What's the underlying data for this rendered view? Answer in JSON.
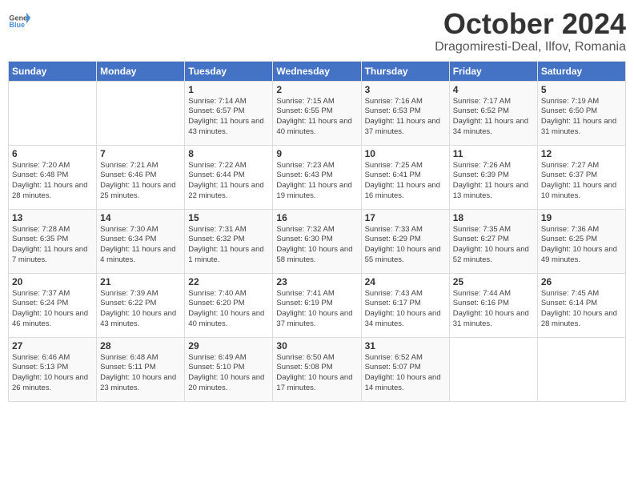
{
  "header": {
    "logo_general": "General",
    "logo_blue": "Blue",
    "month": "October 2024",
    "location": "Dragomiresti-Deal, Ilfov, Romania"
  },
  "days_of_week": [
    "Sunday",
    "Monday",
    "Tuesday",
    "Wednesday",
    "Thursday",
    "Friday",
    "Saturday"
  ],
  "weeks": [
    [
      {
        "day": null,
        "info": null
      },
      {
        "day": null,
        "info": null
      },
      {
        "day": "1",
        "info": "Sunrise: 7:14 AM\nSunset: 6:57 PM\nDaylight: 11 hours and 43 minutes."
      },
      {
        "day": "2",
        "info": "Sunrise: 7:15 AM\nSunset: 6:55 PM\nDaylight: 11 hours and 40 minutes."
      },
      {
        "day": "3",
        "info": "Sunrise: 7:16 AM\nSunset: 6:53 PM\nDaylight: 11 hours and 37 minutes."
      },
      {
        "day": "4",
        "info": "Sunrise: 7:17 AM\nSunset: 6:52 PM\nDaylight: 11 hours and 34 minutes."
      },
      {
        "day": "5",
        "info": "Sunrise: 7:19 AM\nSunset: 6:50 PM\nDaylight: 11 hours and 31 minutes."
      }
    ],
    [
      {
        "day": "6",
        "info": "Sunrise: 7:20 AM\nSunset: 6:48 PM\nDaylight: 11 hours and 28 minutes."
      },
      {
        "day": "7",
        "info": "Sunrise: 7:21 AM\nSunset: 6:46 PM\nDaylight: 11 hours and 25 minutes."
      },
      {
        "day": "8",
        "info": "Sunrise: 7:22 AM\nSunset: 6:44 PM\nDaylight: 11 hours and 22 minutes."
      },
      {
        "day": "9",
        "info": "Sunrise: 7:23 AM\nSunset: 6:43 PM\nDaylight: 11 hours and 19 minutes."
      },
      {
        "day": "10",
        "info": "Sunrise: 7:25 AM\nSunset: 6:41 PM\nDaylight: 11 hours and 16 minutes."
      },
      {
        "day": "11",
        "info": "Sunrise: 7:26 AM\nSunset: 6:39 PM\nDaylight: 11 hours and 13 minutes."
      },
      {
        "day": "12",
        "info": "Sunrise: 7:27 AM\nSunset: 6:37 PM\nDaylight: 11 hours and 10 minutes."
      }
    ],
    [
      {
        "day": "13",
        "info": "Sunrise: 7:28 AM\nSunset: 6:35 PM\nDaylight: 11 hours and 7 minutes."
      },
      {
        "day": "14",
        "info": "Sunrise: 7:30 AM\nSunset: 6:34 PM\nDaylight: 11 hours and 4 minutes."
      },
      {
        "day": "15",
        "info": "Sunrise: 7:31 AM\nSunset: 6:32 PM\nDaylight: 11 hours and 1 minute."
      },
      {
        "day": "16",
        "info": "Sunrise: 7:32 AM\nSunset: 6:30 PM\nDaylight: 10 hours and 58 minutes."
      },
      {
        "day": "17",
        "info": "Sunrise: 7:33 AM\nSunset: 6:29 PM\nDaylight: 10 hours and 55 minutes."
      },
      {
        "day": "18",
        "info": "Sunrise: 7:35 AM\nSunset: 6:27 PM\nDaylight: 10 hours and 52 minutes."
      },
      {
        "day": "19",
        "info": "Sunrise: 7:36 AM\nSunset: 6:25 PM\nDaylight: 10 hours and 49 minutes."
      }
    ],
    [
      {
        "day": "20",
        "info": "Sunrise: 7:37 AM\nSunset: 6:24 PM\nDaylight: 10 hours and 46 minutes."
      },
      {
        "day": "21",
        "info": "Sunrise: 7:39 AM\nSunset: 6:22 PM\nDaylight: 10 hours and 43 minutes."
      },
      {
        "day": "22",
        "info": "Sunrise: 7:40 AM\nSunset: 6:20 PM\nDaylight: 10 hours and 40 minutes."
      },
      {
        "day": "23",
        "info": "Sunrise: 7:41 AM\nSunset: 6:19 PM\nDaylight: 10 hours and 37 minutes."
      },
      {
        "day": "24",
        "info": "Sunrise: 7:43 AM\nSunset: 6:17 PM\nDaylight: 10 hours and 34 minutes."
      },
      {
        "day": "25",
        "info": "Sunrise: 7:44 AM\nSunset: 6:16 PM\nDaylight: 10 hours and 31 minutes."
      },
      {
        "day": "26",
        "info": "Sunrise: 7:45 AM\nSunset: 6:14 PM\nDaylight: 10 hours and 28 minutes."
      }
    ],
    [
      {
        "day": "27",
        "info": "Sunrise: 6:46 AM\nSunset: 5:13 PM\nDaylight: 10 hours and 26 minutes."
      },
      {
        "day": "28",
        "info": "Sunrise: 6:48 AM\nSunset: 5:11 PM\nDaylight: 10 hours and 23 minutes."
      },
      {
        "day": "29",
        "info": "Sunrise: 6:49 AM\nSunset: 5:10 PM\nDaylight: 10 hours and 20 minutes."
      },
      {
        "day": "30",
        "info": "Sunrise: 6:50 AM\nSunset: 5:08 PM\nDaylight: 10 hours and 17 minutes."
      },
      {
        "day": "31",
        "info": "Sunrise: 6:52 AM\nSunset: 5:07 PM\nDaylight: 10 hours and 14 minutes."
      },
      {
        "day": null,
        "info": null
      },
      {
        "day": null,
        "info": null
      }
    ]
  ]
}
